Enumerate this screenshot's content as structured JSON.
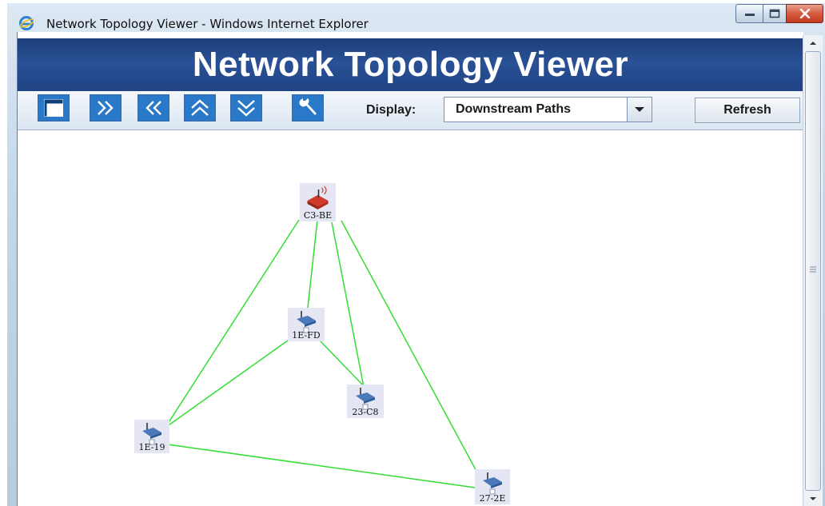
{
  "window": {
    "title": "Network Topology Viewer - Windows Internet Explorer",
    "icon": "ie-logo-icon",
    "controls": [
      "minimize-icon",
      "maximize-icon",
      "close-icon"
    ]
  },
  "app": {
    "title": "Network Topology Viewer"
  },
  "toolbar": {
    "buttons": [
      {
        "name": "window-icon"
      },
      {
        "name": "double-chevron-right-icon"
      },
      {
        "name": "double-chevron-left-icon"
      },
      {
        "name": "double-chevron-up-icon"
      },
      {
        "name": "double-chevron-down-icon"
      },
      {
        "name": "wrench-icon"
      }
    ],
    "display_label": "Display:",
    "display_value": "Downstream Paths",
    "refresh_label": "Refresh"
  },
  "topology": {
    "link_color": "#33dd33",
    "nodes": [
      {
        "id": "C3-BE",
        "type": "router",
        "label": "C3-BE"
      },
      {
        "id": "1E-FD",
        "type": "access-point",
        "label": "1E-FD"
      },
      {
        "id": "23-C8",
        "type": "access-point",
        "label": "23-C8"
      },
      {
        "id": "1E-19",
        "type": "access-point",
        "label": "1E-19"
      },
      {
        "id": "27-2E",
        "type": "access-point",
        "label": "27-2E"
      }
    ],
    "links": [
      [
        "C3-BE",
        "1E-19"
      ],
      [
        "C3-BE",
        "1E-FD"
      ],
      [
        "C3-BE",
        "23-C8"
      ],
      [
        "C3-BE",
        "27-2E"
      ],
      [
        "1E-FD",
        "1E-19"
      ],
      [
        "1E-FD",
        "23-C8"
      ],
      [
        "1E-19",
        "27-2E"
      ]
    ]
  },
  "colors": {
    "banner": "#2a5196",
    "toolbar_button": "#2a78c8",
    "router": "#d03a2a",
    "access_point": "#4a78b8"
  }
}
